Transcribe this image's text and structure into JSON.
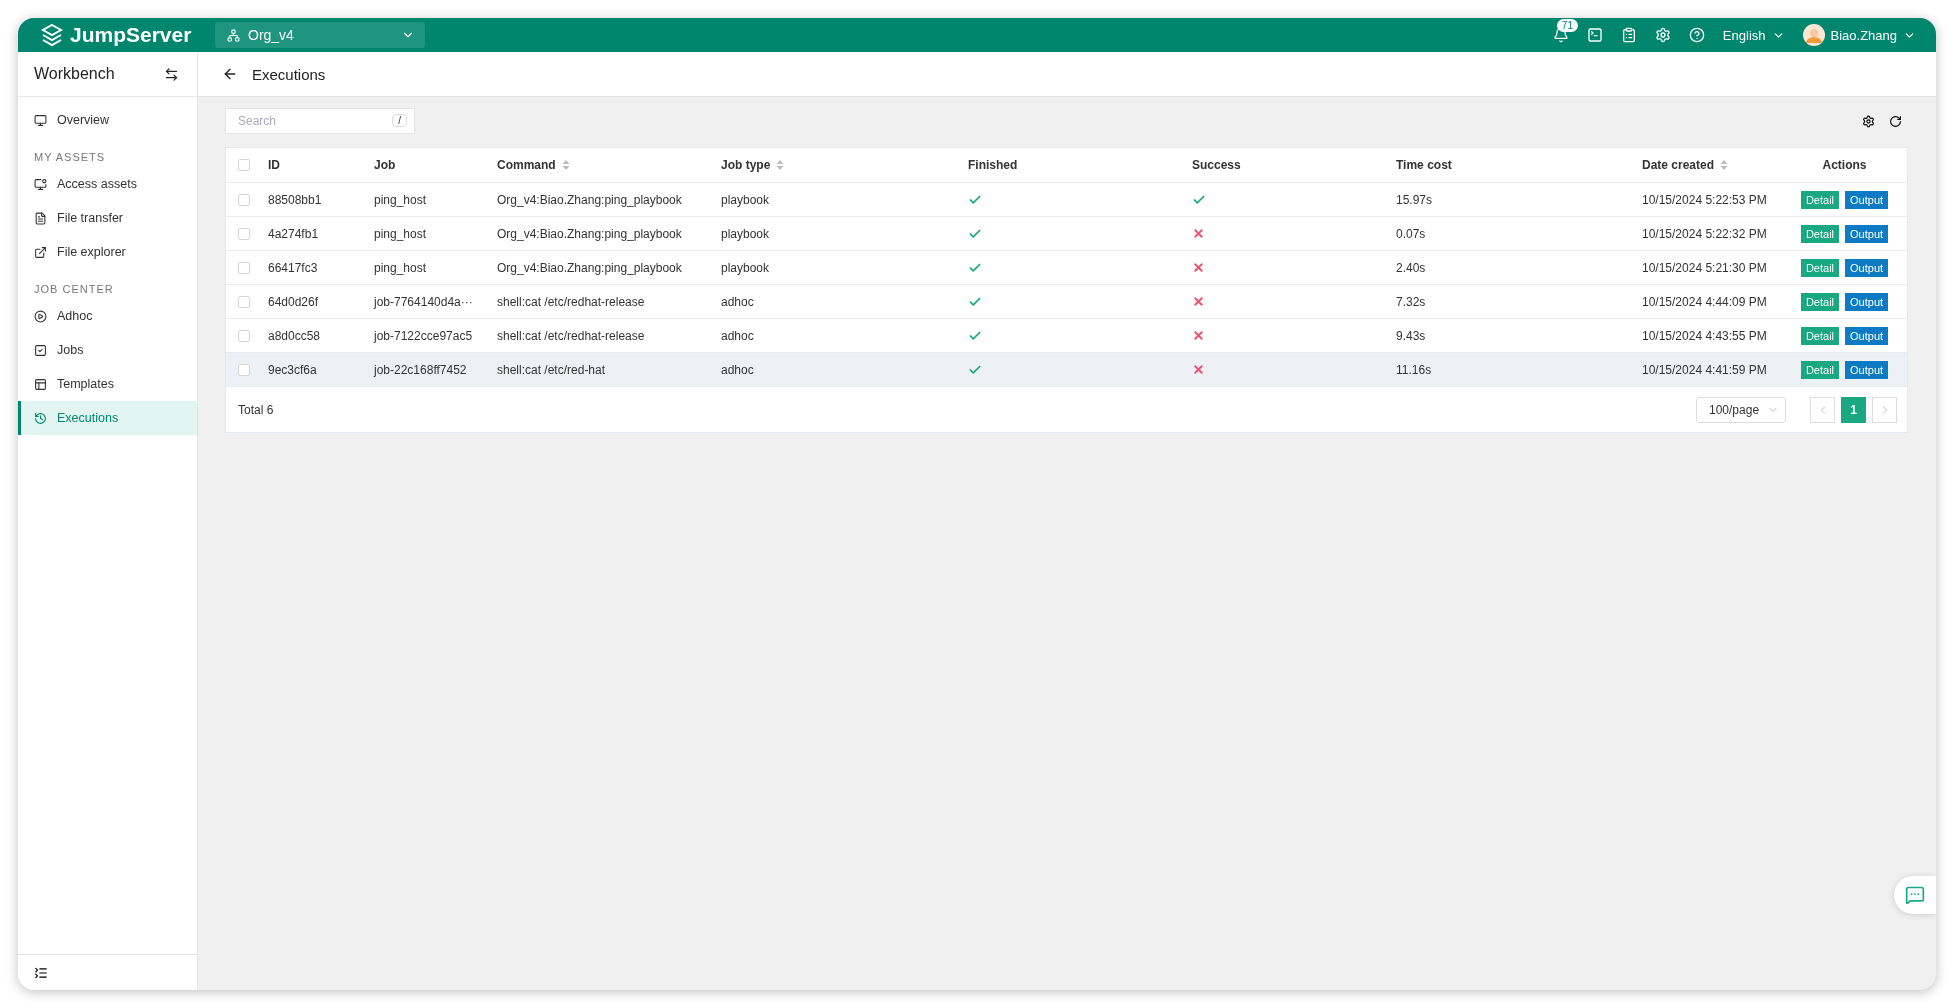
{
  "topbar": {
    "logo": "JumpServer",
    "org": "Org_v4",
    "notifications": "71",
    "language": "English",
    "user": "Biao.Zhang"
  },
  "sidebar": {
    "title": "Workbench",
    "sections": [
      {
        "items": [
          {
            "label": "Overview",
            "selected": false
          }
        ]
      },
      {
        "heading": "MY ASSETS",
        "items": [
          {
            "label": "Access assets",
            "selected": false
          },
          {
            "label": "File transfer",
            "selected": false
          },
          {
            "label": "File explorer",
            "selected": false
          }
        ]
      },
      {
        "heading": "JOB CENTER",
        "items": [
          {
            "label": "Adhoc",
            "selected": false
          },
          {
            "label": "Jobs",
            "selected": false
          },
          {
            "label": "Templates",
            "selected": false
          },
          {
            "label": "Executions",
            "selected": true
          }
        ]
      }
    ]
  },
  "page": {
    "title": "Executions"
  },
  "search": {
    "placeholder": "Search",
    "shortcut": "/"
  },
  "table": {
    "all_checked": false,
    "columns": [
      {
        "label": "ID",
        "sortable": false
      },
      {
        "label": "Job",
        "sortable": false
      },
      {
        "label": "Command",
        "sortable": true
      },
      {
        "label": "Job type",
        "sortable": true
      },
      {
        "label": "Finished",
        "sortable": false
      },
      {
        "label": "Success",
        "sortable": false
      },
      {
        "label": "Time cost",
        "sortable": false
      },
      {
        "label": "Date created",
        "sortable": true
      },
      {
        "label": "Actions",
        "sortable": false
      }
    ],
    "rows": [
      {
        "checked": false,
        "hovered": false,
        "id": "88508bb1",
        "job": "ping_host",
        "command": "Org_v4:Biao.Zhang:ping_playbook",
        "job_type": "playbook",
        "finished": true,
        "success": true,
        "time_cost": "15.97s",
        "date_created": "10/15/2024 5:22:53 PM",
        "actions": [
          "Detail",
          "Output"
        ]
      },
      {
        "checked": false,
        "hovered": false,
        "id": "4a274fb1",
        "job": "ping_host",
        "command": "Org_v4:Biao.Zhang:ping_playbook",
        "job_type": "playbook",
        "finished": true,
        "success": false,
        "time_cost": "0.07s",
        "date_created": "10/15/2024 5:22:32 PM",
        "actions": [
          "Detail",
          "Output"
        ]
      },
      {
        "checked": false,
        "hovered": false,
        "id": "66417fc3",
        "job": "ping_host",
        "command": "Org_v4:Biao.Zhang:ping_playbook",
        "job_type": "playbook",
        "finished": true,
        "success": false,
        "time_cost": "2.40s",
        "date_created": "10/15/2024 5:21:30 PM",
        "actions": [
          "Detail",
          "Output"
        ]
      },
      {
        "checked": false,
        "hovered": false,
        "id": "64d0d26f",
        "job": "job-7764140d4a···",
        "command": "shell:cat /etc/redhat-release",
        "job_type": "adhoc",
        "finished": true,
        "success": false,
        "time_cost": "7.32s",
        "date_created": "10/15/2024 4:44:09 PM",
        "actions": [
          "Detail",
          "Output"
        ]
      },
      {
        "checked": false,
        "hovered": false,
        "id": "a8d0cc58",
        "job": "job-7122cce97ac5",
        "command": "shell:cat /etc/redhat-release",
        "job_type": "adhoc",
        "finished": true,
        "success": false,
        "time_cost": "9.43s",
        "date_created": "10/15/2024 4:43:55 PM",
        "actions": [
          "Detail",
          "Output"
        ]
      },
      {
        "checked": false,
        "hovered": true,
        "id": "9ec3cf6a",
        "job": "job-22c168ff7452",
        "command": "shell:cat /etc/red-hat",
        "job_type": "adhoc",
        "finished": true,
        "success": false,
        "time_cost": "11.16s",
        "date_created": "10/15/2024 4:41:59 PM",
        "actions": [
          "Detail",
          "Output"
        ]
      }
    ]
  },
  "pagination": {
    "total": "Total 6",
    "page_size": "100/page",
    "pages": [
      {
        "label": "1",
        "selected": true
      }
    ]
  }
}
